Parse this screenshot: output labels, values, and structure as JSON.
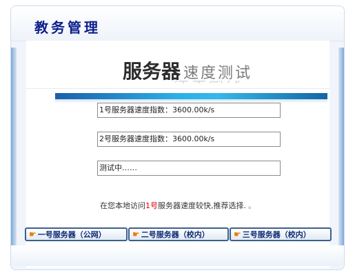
{
  "app": {
    "title": "教务管理"
  },
  "heading": {
    "main": "服务器",
    "sub": "速度测试"
  },
  "tests": [
    {
      "label": "1号服务器速度指数：3600.00k/s"
    },
    {
      "label": "2号服务器速度指数：3600.00k/s"
    },
    {
      "label": "测试中……"
    }
  ],
  "note": {
    "prefix": "在您本地访问",
    "server": "1号",
    "suffix": "服务器速度较快,推荐选择.",
    "tail": "。"
  },
  "buttons": [
    {
      "icon": "pointing-hand-icon",
      "label": "一号服务器（公网）"
    },
    {
      "icon": "pointing-hand-icon",
      "label": "二号服务器（校内）"
    },
    {
      "icon": "pointing-hand-icon",
      "label": "三号服务器（校内）"
    }
  ],
  "colors": {
    "title": "#0d1e8a",
    "accent_bar": "#2ab0e6",
    "highlight": "#e60000",
    "button_text": "#0f2a75",
    "hand_icon": "#f07a00"
  }
}
